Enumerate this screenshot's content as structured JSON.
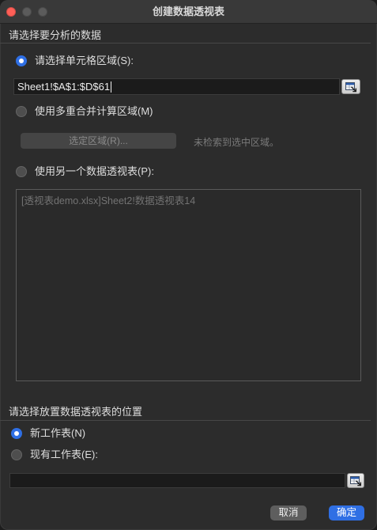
{
  "window": {
    "title": "创建数据透视表",
    "traffic_lights": {
      "close": "#ff5f57",
      "minimize": "#5b5b5b",
      "zoom": "#5b5b5b"
    }
  },
  "theme": {
    "accent": "#2f6fe4",
    "window_background": "#2c2c2c",
    "titlebar_background": "#393939",
    "text": "#dedede",
    "muted_text": "#7a7a7a"
  },
  "source": {
    "heading": "请选择要分析的数据",
    "options": {
      "cell_range": {
        "label": "请选择单元格区域(S):",
        "selected": true
      },
      "multiple_consolidation": {
        "label": "使用多重合并计算区域(M)",
        "selected": false
      },
      "another_pivot": {
        "label": "使用另一个数据透视表(P):",
        "selected": false
      }
    },
    "range_field": {
      "value": "Sheet1!$A$1:$D$61",
      "picker_icon": "range-select-icon"
    },
    "select_region_button": {
      "label": "选定区域(R)...",
      "disabled": true
    },
    "region_status": "未检索到选中区域。",
    "pivot_tables": [
      "[透视表demo.xlsx]Sheet2!数据透视表14"
    ]
  },
  "destination": {
    "heading": "请选择放置数据透视表的位置",
    "options": {
      "new_sheet": {
        "label": "新工作表(N)",
        "selected": true
      },
      "existing_sheet": {
        "label": "现有工作表(E):",
        "selected": false
      }
    },
    "location_field": {
      "value": "",
      "picker_icon": "range-select-icon"
    }
  },
  "buttons": {
    "cancel": "取消",
    "ok": "确定"
  }
}
